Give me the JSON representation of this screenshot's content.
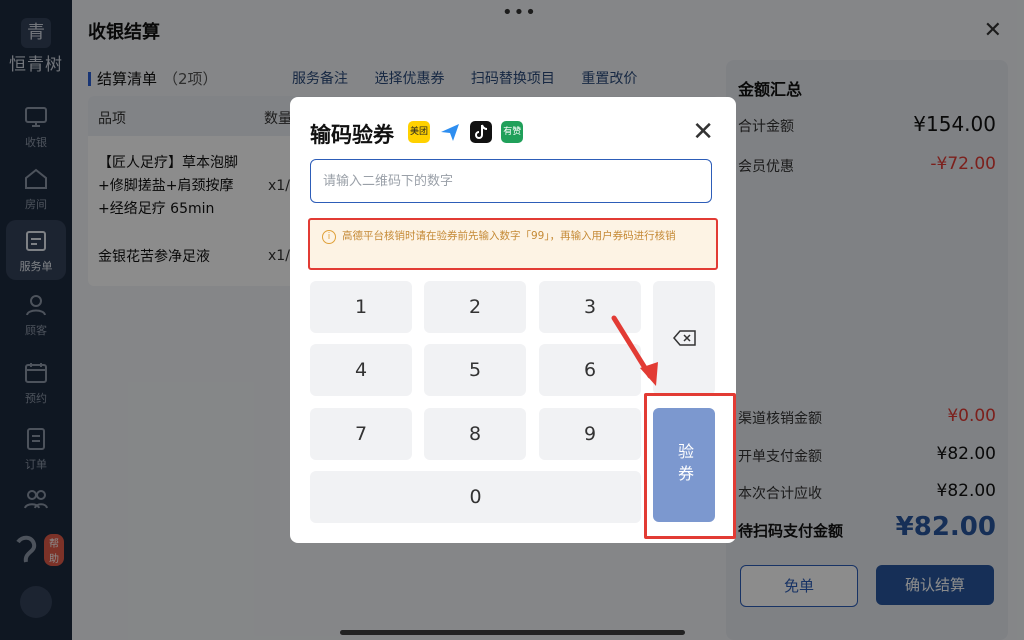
{
  "sidebar": {
    "logo_mark": "青",
    "brand": "恒青树",
    "items": [
      {
        "label": "收银",
        "icon": "cashier-icon"
      },
      {
        "label": "房间",
        "icon": "room-icon"
      },
      {
        "label": "服务单",
        "icon": "service-order-icon",
        "active": true
      },
      {
        "label": "顾客",
        "icon": "customer-icon"
      },
      {
        "label": "预约",
        "icon": "reservation-icon"
      },
      {
        "label": "订单",
        "icon": "order-icon"
      },
      {
        "label": "",
        "icon": "staff-icon"
      }
    ],
    "help_badge": "帮助"
  },
  "panel": {
    "title": "收银结算",
    "list_title": "结算清单",
    "list_count": "（2项）",
    "actions": [
      "服务备注",
      "选择优惠券",
      "扫码替换项目",
      "重置改价"
    ],
    "columns": [
      "品项",
      "数量"
    ],
    "rows": [
      {
        "name_lines": [
          "【匠人足疗】草本泡脚",
          "+修脚搓盐+肩颈按摩",
          "+经络足疗 65min"
        ],
        "qty": "x1/"
      },
      {
        "name_lines": [
          "金银花苦参净足液"
        ],
        "qty": "x1/"
      }
    ]
  },
  "summary": {
    "title": "金额汇总",
    "total_label": "合计金额",
    "total_value": "¥154.00",
    "member_label": "会员优惠",
    "member_value": "-¥72.00",
    "channel_label": "渠道核销金额",
    "channel_value": "¥0.00",
    "open_label": "开单支付金额",
    "open_value": "¥82.00",
    "due_label": "本次合计应收",
    "due_value": "¥82.00",
    "pending_label": "待扫码支付金额",
    "pending_value": "¥82.00",
    "free_button": "免单",
    "confirm_button": "确认结算"
  },
  "dialog": {
    "title": "输码验券",
    "platforms": [
      {
        "label": "美团",
        "color": "#ffd100",
        "text_color": "#222"
      },
      {
        "label": "",
        "color": "#ffffff"
      },
      {
        "label": "",
        "color": "#111111"
      },
      {
        "label": "有赞",
        "color": "#20a05a",
        "text_color": "#fff"
      }
    ],
    "input_placeholder": "请输入二维码下的数字",
    "notice": "高德平台核销时请在验券前先输入数字「99」，再输入用户券码进行核销",
    "keys": [
      "1",
      "2",
      "3",
      "4",
      "5",
      "6",
      "7",
      "8",
      "9",
      "0"
    ],
    "verify_label": "验券"
  },
  "colors": {
    "accent": "#2d5db8",
    "danger": "#e23b34",
    "verify_button": "#7c98cf",
    "sidebar": "#1d2a3f"
  }
}
